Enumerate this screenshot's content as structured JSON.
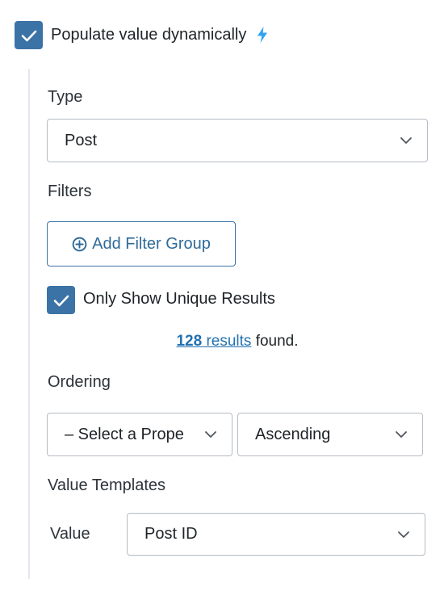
{
  "populate": {
    "label": "Populate value dynamically",
    "checked": true,
    "icon": "lightning-bolt-icon"
  },
  "type": {
    "label": "Type",
    "value": "Post"
  },
  "filters": {
    "label": "Filters",
    "add_button": "Add Filter Group"
  },
  "unique": {
    "label": "Only Show Unique Results",
    "checked": true
  },
  "results": {
    "count": "128",
    "link_word": "results",
    "suffix": " found."
  },
  "ordering": {
    "label": "Ordering",
    "property_value": "– Select a Prope",
    "direction_value": "Ascending"
  },
  "templates": {
    "label": "Value Templates",
    "value_label": "Value",
    "value_select": "Post ID"
  },
  "colors": {
    "accent": "#3b73a6",
    "link": "#2271b1",
    "bolt": "#2ea3f2",
    "border": "#b5bcc4"
  }
}
